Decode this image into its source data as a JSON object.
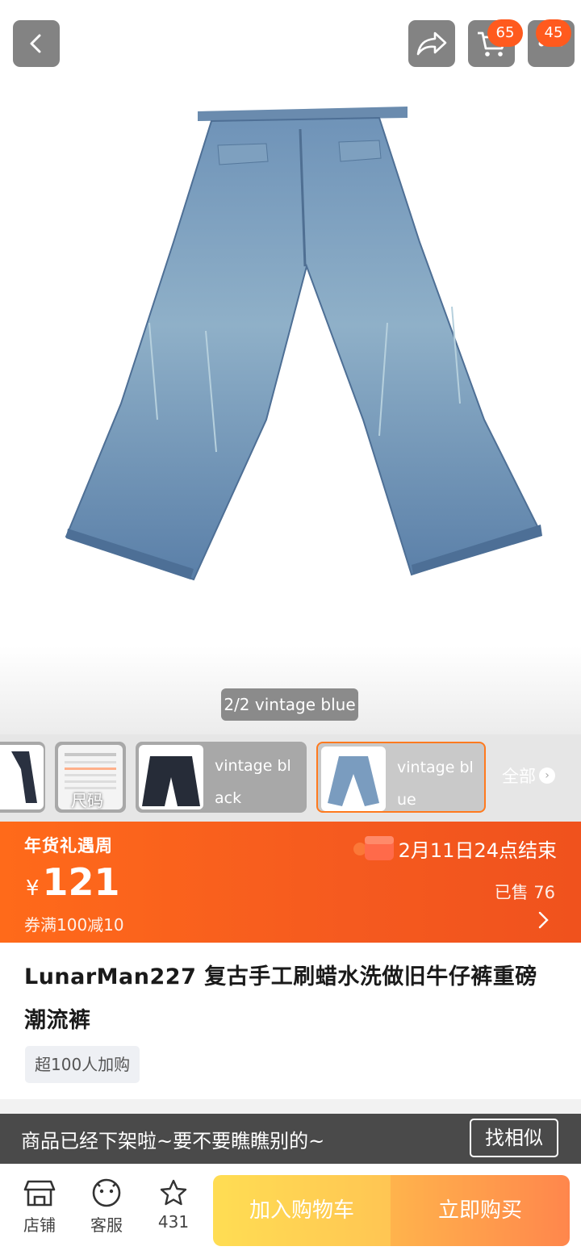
{
  "header": {
    "cart_badge": "65",
    "more_badge": "45"
  },
  "gallery": {
    "counter": "2/2 vintage blue"
  },
  "variants": {
    "items": [
      {
        "label": ""
      },
      {
        "label": "尺码"
      },
      {
        "label": "vintage black"
      },
      {
        "label": "vintage blue"
      }
    ],
    "size_label": "尺码",
    "black_label": "vintage bl ack",
    "blue_label": "vintage bl ue",
    "all_label": "全部"
  },
  "promo": {
    "event_title": "年货礼遇周",
    "end_text": "2月11日24点结束",
    "currency": "¥",
    "price": "121",
    "sold": "已售 76",
    "coupon": "券满100减10"
  },
  "product": {
    "title": "LunarMan227 复古手工刷蜡水洗做旧牛仔裤重磅潮流裤",
    "tag": "超100人加购"
  },
  "notice": {
    "text": "商品已经下架啦~要不要瞧瞧别的~",
    "button": "找相似"
  },
  "bottom_bar": {
    "shop_label": "店铺",
    "service_label": "客服",
    "favorites_count": "431",
    "add_to_cart": "加入购物车",
    "buy_now": "立即购买"
  },
  "colors": {
    "accent_orange": "#ff5a1e",
    "promo_bg": "#f55a1f",
    "offline_bar": "#4a4a4a"
  }
}
